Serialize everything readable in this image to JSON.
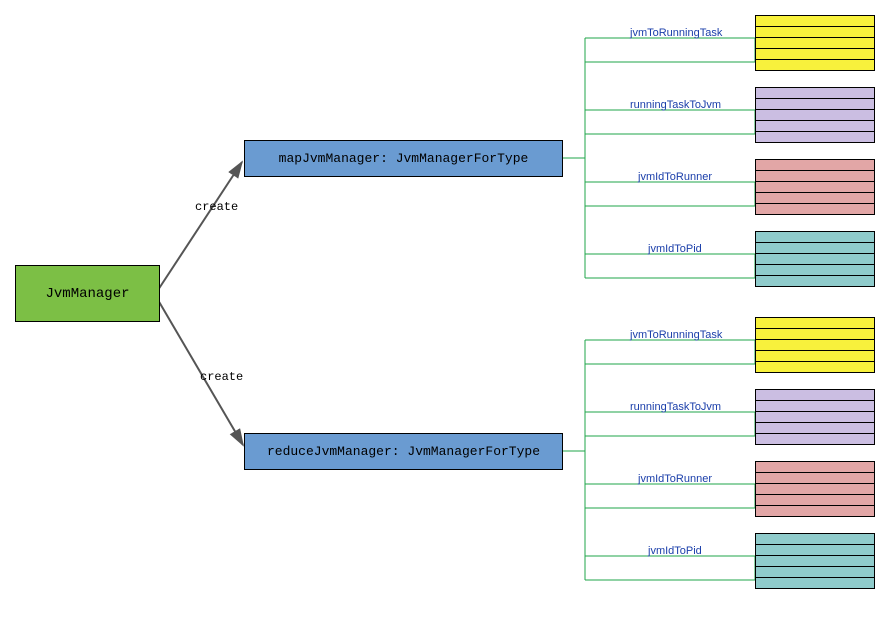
{
  "root": {
    "label": "JvmManager"
  },
  "edges": {
    "create1": "create",
    "create2": "create"
  },
  "managers": {
    "map": "mapJvmManager: JvmManagerForType",
    "reduce": "reduceJvmManager: JvmManagerForType"
  },
  "fields": {
    "jvmToRunningTask": "jvmToRunningTask",
    "runningTaskToJvm": "runningTaskToJvm",
    "jvmIdToRunner": "jvmIdToRunner",
    "jvmIdToPid": "jvmIdToPid"
  },
  "colors": {
    "root": "#7CBF45",
    "manager": "#6A9BD1",
    "yellow": "#F8F13C",
    "purple": "#CBBEE2",
    "pink": "#E2A6A6",
    "teal": "#8FCBCB",
    "line_green": "#1FA54A",
    "line_grey": "#555",
    "field_text": "#1A3EAA"
  },
  "diagram_structure": {
    "type": "tree",
    "root": "JvmManager",
    "children": [
      {
        "name": "mapJvmManager",
        "type": "JvmManagerForType",
        "relation": "create",
        "fields": [
          {
            "name": "jvmToRunningTask",
            "color": "yellow"
          },
          {
            "name": "runningTaskToJvm",
            "color": "purple"
          },
          {
            "name": "jvmIdToRunner",
            "color": "pink"
          },
          {
            "name": "jvmIdToPid",
            "color": "teal"
          }
        ]
      },
      {
        "name": "reduceJvmManager",
        "type": "JvmManagerForType",
        "relation": "create",
        "fields": [
          {
            "name": "jvmToRunningTask",
            "color": "yellow"
          },
          {
            "name": "runningTaskToJvm",
            "color": "purple"
          },
          {
            "name": "jvmIdToRunner",
            "color": "pink"
          },
          {
            "name": "jvmIdToPid",
            "color": "teal"
          }
        ]
      }
    ]
  }
}
